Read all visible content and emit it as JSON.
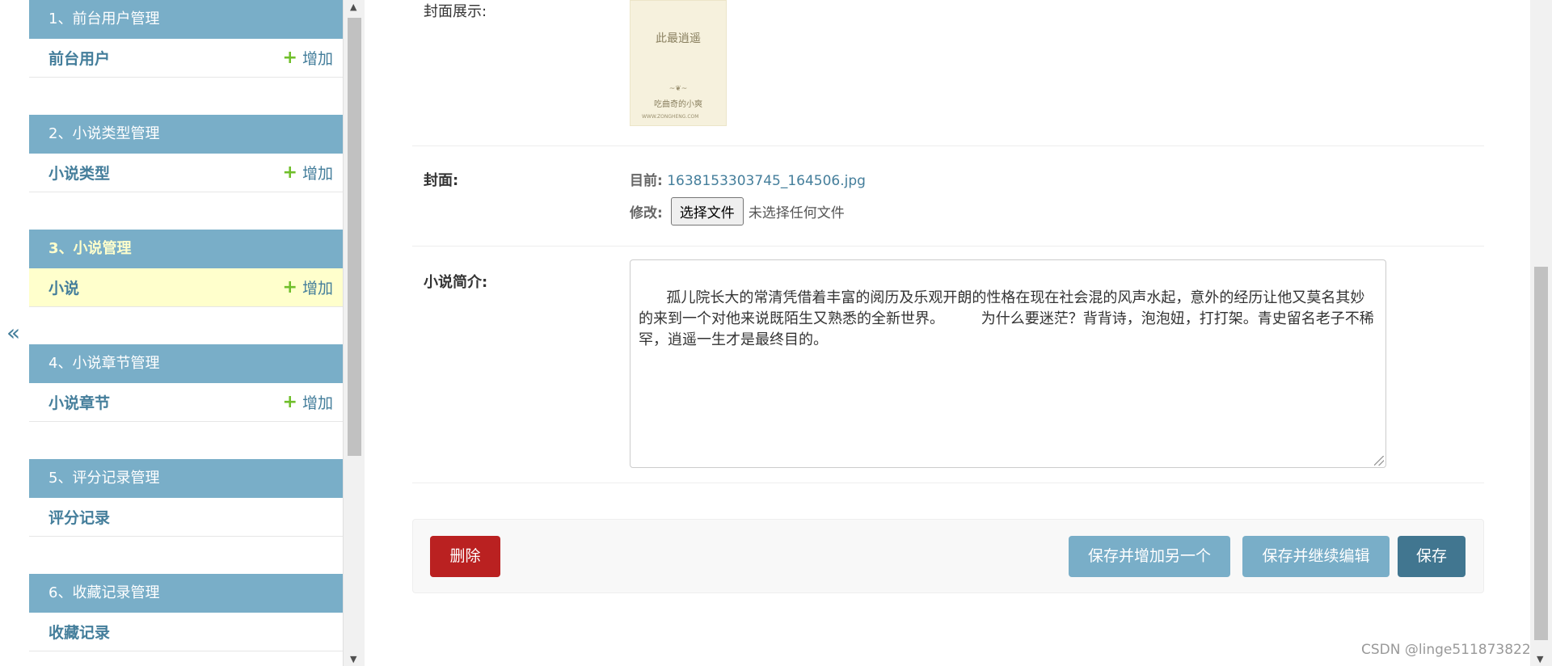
{
  "sidebar": {
    "collapse_icon": "«",
    "modules": [
      {
        "header": "1、前台用户管理",
        "model": "前台用户",
        "add": "增加"
      },
      {
        "header": "2、小说类型管理",
        "model": "小说类型",
        "add": "增加"
      },
      {
        "header": "3、小说管理",
        "model": "小说",
        "add": "增加"
      },
      {
        "header": "4、小说章节管理",
        "model": "小说章节",
        "add": "增加"
      },
      {
        "header": "5、评分记录管理",
        "model": "评分记录"
      },
      {
        "header": "6、收藏记录管理",
        "model": "收藏记录"
      }
    ],
    "add_icon": "+"
  },
  "form": {
    "cover_display_label": "封面展示:",
    "cover_image": {
      "title": "此最逍遥",
      "author": "吃曲奇的小爽",
      "site": "WWW.ZONGHENG.COM"
    },
    "cover_label": "封面:",
    "cover_current_label": "目前:",
    "cover_current_file": "1638153303745_164506.jpg",
    "cover_change_label": "修改:",
    "file_button": "选择文件",
    "file_none": "未选择任何文件",
    "intro_label": "小说简介:",
    "intro_text": "孤儿院长大的常清凭借着丰富的阅历及乐观开朗的性格在现在社会混的风声水起，意外的经历让他又莫名其妙的来到一个对他来说既陌生又熟悉的全新世界。        为什么要迷茫？背背诗，泡泡妞，打打架。青史留名老子不稀罕，逍遥一生才是最终目的。"
  },
  "submit": {
    "delete": "删除",
    "save_add_another": "保存并增加另一个",
    "save_continue": "保存并继续编辑",
    "save": "保存"
  },
  "watermark": "CSDN @linge511873822",
  "colors": {
    "module_header": "#79aec8",
    "link": "#447e9b",
    "current_bg": "#ffffcc",
    "delete": "#ba2121",
    "save_primary": "#417690",
    "add_plus": "#70bf2b"
  }
}
